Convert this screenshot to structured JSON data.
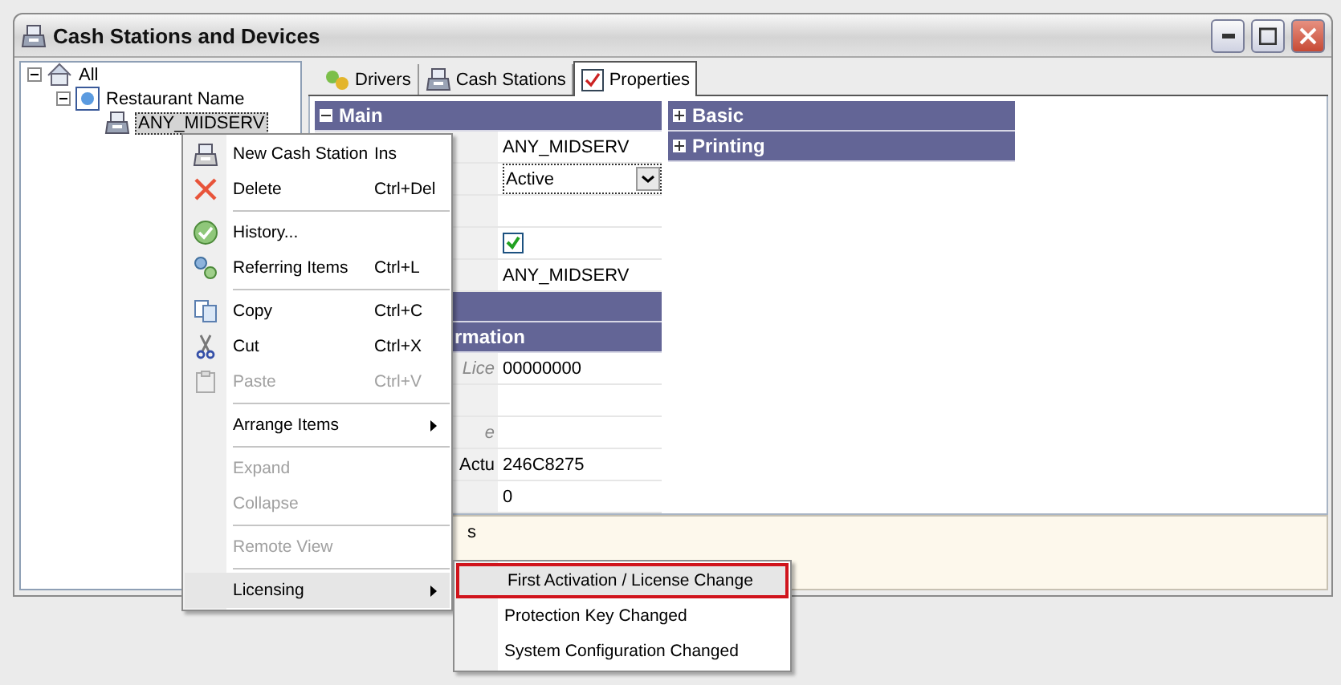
{
  "window": {
    "title": "Cash Stations and Devices"
  },
  "tree": [
    {
      "label": "All",
      "expanded": true,
      "selected": false,
      "children": [
        {
          "label": "Restaurant Name",
          "expanded": true,
          "selected": false,
          "children": [
            {
              "label": "ANY_MIDSERV",
              "selected": true
            }
          ]
        }
      ]
    }
  ],
  "tabs": [
    {
      "label": "Drivers",
      "selected": false
    },
    {
      "label": "Cash Stations",
      "selected": false
    },
    {
      "label": "Properties",
      "selected": true
    }
  ],
  "main_grid": {
    "sections": [
      {
        "kind": "category",
        "title": "Main",
        "expanded": true,
        "rows": [
          {
            "kind": "text",
            "value": "ANY_MIDSERV"
          },
          {
            "kind": "dropdown",
            "value": "Active"
          },
          {
            "kind": "text"
          },
          {
            "kind": "checkbox",
            "checked": true
          },
          {
            "kind": "text",
            "value": "ANY_MIDSERV"
          }
        ]
      },
      {
        "kind": "category"
      },
      {
        "kind": "category",
        "title": "rmation",
        "partial": true,
        "expanded": true,
        "rows": [
          {
            "kind": "text",
            "label": "Lice",
            "readonly": true,
            "value": "00000000"
          },
          {
            "kind": "text"
          },
          {
            "kind": "text",
            "label": "e",
            "readonly": true
          },
          {
            "kind": "text",
            "label": "Actu",
            "readonly": false,
            "value": "246C8275"
          },
          {
            "kind": "text",
            "value": "0"
          }
        ]
      }
    ]
  },
  "side_grid": {
    "sections": [
      {
        "title": "Basic",
        "expanded": false
      },
      {
        "title": "Printing",
        "expanded": false
      }
    ]
  },
  "description": {
    "text": "s"
  },
  "context_menu": {
    "groups": [
      [
        {
          "label": "New Cash Station",
          "shortcut": "Ins",
          "disabled": false,
          "selected": false
        },
        {
          "label": "Delete",
          "shortcut": "Ctrl+Del",
          "disabled": false,
          "selected": false
        }
      ],
      [
        {
          "label": "History...",
          "disabled": false,
          "selected": false
        },
        {
          "label": "Referring Items",
          "shortcut": "Ctrl+L",
          "disabled": false,
          "selected": false
        }
      ],
      [
        {
          "label": "Copy",
          "shortcut": "Ctrl+C",
          "disabled": false,
          "selected": false
        },
        {
          "label": "Cut",
          "shortcut": "Ctrl+X",
          "disabled": false,
          "selected": false
        },
        {
          "label": "Paste",
          "shortcut": "Ctrl+V",
          "disabled": true,
          "selected": false
        }
      ],
      [
        {
          "label": "Arrange Items",
          "submenu": true,
          "disabled": false,
          "selected": false
        }
      ],
      [
        {
          "label": "Expand",
          "disabled": true,
          "selected": false
        },
        {
          "label": "Collapse",
          "disabled": true,
          "selected": false
        }
      ],
      [
        {
          "label": "Remote View",
          "disabled": true,
          "selected": false
        }
      ],
      [
        {
          "label": "Licensing",
          "submenu": true,
          "disabled": false,
          "selected": true
        }
      ]
    ]
  },
  "submenu": {
    "items": [
      {
        "label": "First Activation / License Change",
        "selected": true,
        "highlighted": true
      },
      {
        "label": "Protection Key Changed",
        "selected": false,
        "highlighted": false
      },
      {
        "label": "System Configuration Changed",
        "selected": false,
        "highlighted": false
      }
    ]
  }
}
